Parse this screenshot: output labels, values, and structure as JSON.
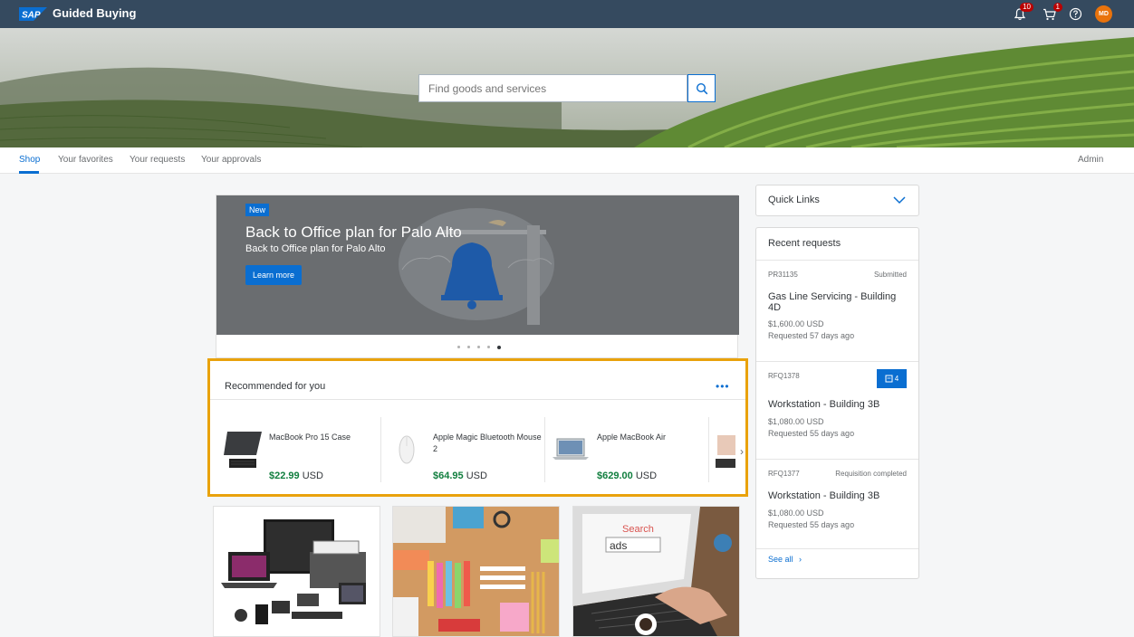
{
  "header": {
    "logo_text": "SAP",
    "app_title": "Guided Buying",
    "notifications_count": "10",
    "cart_count": "1",
    "user_initials": "MD"
  },
  "search": {
    "placeholder": "Find goods and services"
  },
  "tabs": [
    {
      "label": "Shop"
    },
    {
      "label": "Your favorites"
    },
    {
      "label": "Your requests"
    },
    {
      "label": "Your approvals"
    }
  ],
  "admin_label": "Admin",
  "carousel": {
    "badge": "New",
    "title": "Back to Office plan for Palo Alto",
    "subtitle": "Back to Office plan for Palo Alto",
    "button": "Learn more"
  },
  "recommended": {
    "title": "Recommended for you",
    "more": "•••",
    "products": [
      {
        "name": "MacBook Pro 15 Case",
        "price": "$22.99",
        "currency": "USD"
      },
      {
        "name": "Apple Magic Bluetooth Mouse 2",
        "price": "$64.95",
        "currency": "USD"
      },
      {
        "name": "Apple MacBook Air",
        "price": "$629.00",
        "currency": "USD"
      }
    ]
  },
  "quick_links": {
    "label": "Quick Links"
  },
  "recent_requests": {
    "title": "Recent requests",
    "items": [
      {
        "id": "PR31135",
        "status": "Submitted",
        "name": "Gas Line Servicing - Building 4D",
        "amount": "$1,600.00 USD",
        "time": "Requested 57 days ago"
      },
      {
        "id": "RFQ1378",
        "status": "",
        "badge": "4",
        "name": "Workstation - Building 3B",
        "amount": "$1,080.00 USD",
        "time": "Requested 55 days ago"
      },
      {
        "id": "RFQ1377",
        "status": "Requisition completed",
        "name": "Workstation - Building 3B",
        "amount": "$1,080.00 USD",
        "time": "Requested 55 days ago"
      }
    ],
    "see_all": "See all"
  }
}
